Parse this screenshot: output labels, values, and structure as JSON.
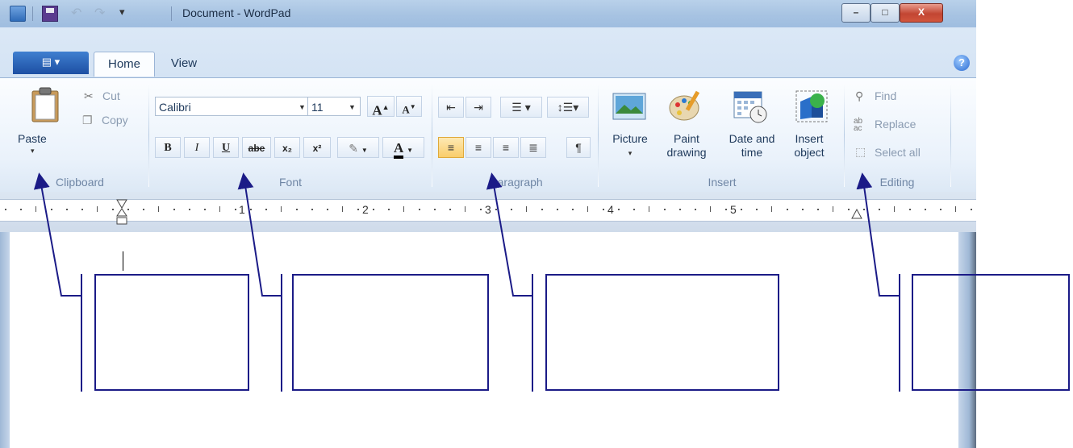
{
  "window": {
    "title": "Document - WordPad",
    "controls": {
      "minimize": "–",
      "maximize": "□",
      "close": "X"
    }
  },
  "quick_access": {
    "icons": [
      "app-icon",
      "save-icon",
      "undo-icon",
      "redo-icon",
      "customize-dropdown-icon"
    ]
  },
  "tabs": [
    {
      "label": "Home",
      "selected": true
    },
    {
      "label": "View",
      "selected": false
    }
  ],
  "ribbon": {
    "clipboard": {
      "label": "Clipboard",
      "paste": "Paste",
      "cut": "Cut",
      "copy": "Copy"
    },
    "font": {
      "label": "Font",
      "family": "Calibri",
      "size": "11",
      "grow": "A",
      "shrink": "A",
      "bold": "B",
      "italic": "I",
      "underline": "U",
      "strikethrough": "abe",
      "subscript": "x₂",
      "superscript": "x²",
      "text_color": "A"
    },
    "paragraph": {
      "label": "Paragraph",
      "active_alignment": "left"
    },
    "insert": {
      "label": "Insert",
      "picture": "Picture",
      "paint_1": "Paint",
      "paint_2": "drawing",
      "date_1": "Date and",
      "date_2": "time",
      "object_1": "Insert",
      "object_2": "object"
    },
    "editing": {
      "label": "Editing",
      "find": "Find",
      "replace": "Replace",
      "select_all": "Select all"
    }
  },
  "ruler": {
    "numbers": [
      "1",
      "2",
      "3",
      "4",
      "5"
    ]
  },
  "colors": {
    "callout_border": "#1b1b87",
    "ribbon_text": "#1e395b",
    "file_tab": "#2b63b9",
    "accent_active": "#f9cd6a"
  }
}
